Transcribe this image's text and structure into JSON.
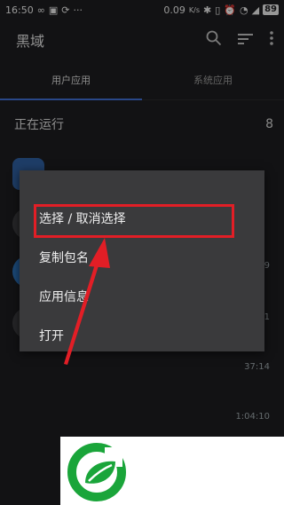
{
  "status_bar": {
    "time": "16:50",
    "net_speed": "0.09",
    "net_unit": "K/s",
    "battery": "89"
  },
  "app_bar": {
    "title": "黑域"
  },
  "tabs": [
    {
      "label": "用户应用",
      "active": true
    },
    {
      "label": "系统应用",
      "active": false
    }
  ],
  "section": {
    "title": "正在运行",
    "count": "8"
  },
  "list_rows": [
    {
      "time": "39"
    },
    {
      "time": "1"
    },
    {
      "time": "37:14"
    },
    {
      "time": "1:04:10"
    }
  ],
  "context_menu": {
    "items": [
      {
        "label": "选择 / 取消选择"
      },
      {
        "label": "复制包名"
      },
      {
        "label": "应用信息"
      },
      {
        "label": "打开"
      }
    ]
  },
  "colors": {
    "highlight": "#e21e26",
    "tab_indicator": "#3f6ed1",
    "logo_green": "#1aa53a"
  }
}
